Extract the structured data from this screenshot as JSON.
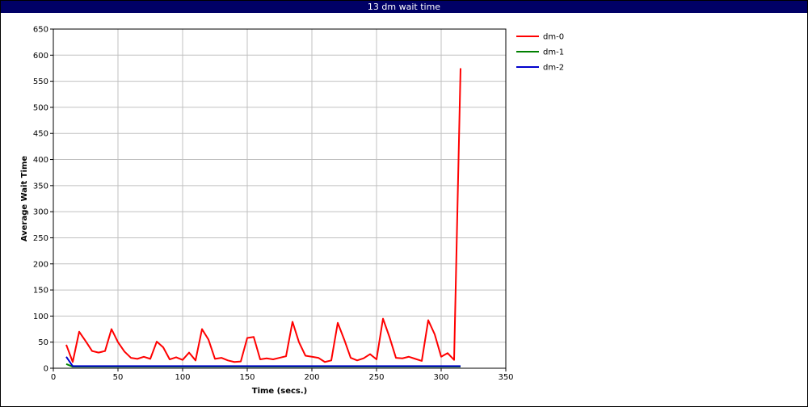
{
  "title": "13 dm wait time",
  "chart_data": {
    "type": "line",
    "title": "13 dm wait time",
    "xlabel": "Time (secs.)",
    "ylabel": "Average Wait Time",
    "xlim": [
      0,
      350
    ],
    "ylim": [
      0,
      650
    ],
    "x_ticks": [
      0,
      50,
      100,
      150,
      200,
      250,
      300,
      350
    ],
    "y_ticks": [
      0,
      50,
      100,
      150,
      200,
      250,
      300,
      350,
      400,
      450,
      500,
      550,
      600,
      650
    ],
    "grid": true,
    "legend_position": "right",
    "series": [
      {
        "name": "dm-0",
        "color": "#ff0000",
        "points": [
          [
            10,
            45
          ],
          [
            15,
            12
          ],
          [
            20,
            70
          ],
          [
            25,
            52
          ],
          [
            30,
            33
          ],
          [
            35,
            30
          ],
          [
            40,
            33
          ],
          [
            45,
            75
          ],
          [
            50,
            50
          ],
          [
            55,
            32
          ],
          [
            60,
            20
          ],
          [
            65,
            18
          ],
          [
            70,
            22
          ],
          [
            75,
            18
          ],
          [
            80,
            51
          ],
          [
            85,
            40
          ],
          [
            90,
            17
          ],
          [
            95,
            21
          ],
          [
            100,
            16
          ],
          [
            105,
            30
          ],
          [
            110,
            15
          ],
          [
            115,
            75
          ],
          [
            120,
            55
          ],
          [
            125,
            18
          ],
          [
            130,
            20
          ],
          [
            135,
            15
          ],
          [
            140,
            12
          ],
          [
            145,
            13
          ],
          [
            150,
            58
          ],
          [
            155,
            60
          ],
          [
            160,
            17
          ],
          [
            165,
            19
          ],
          [
            170,
            17
          ],
          [
            175,
            20
          ],
          [
            180,
            23
          ],
          [
            185,
            89
          ],
          [
            190,
            50
          ],
          [
            195,
            24
          ],
          [
            200,
            22
          ],
          [
            205,
            20
          ],
          [
            210,
            12
          ],
          [
            215,
            15
          ],
          [
            220,
            87
          ],
          [
            225,
            55
          ],
          [
            230,
            20
          ],
          [
            235,
            15
          ],
          [
            240,
            19
          ],
          [
            245,
            27
          ],
          [
            250,
            17
          ],
          [
            255,
            95
          ],
          [
            260,
            60
          ],
          [
            265,
            20
          ],
          [
            270,
            19
          ],
          [
            275,
            22
          ],
          [
            280,
            18
          ],
          [
            285,
            14
          ],
          [
            290,
            92
          ],
          [
            295,
            65
          ],
          [
            300,
            22
          ],
          [
            305,
            29
          ],
          [
            310,
            16
          ],
          [
            315,
            575
          ]
        ]
      },
      {
        "name": "dm-1",
        "color": "#008000",
        "points": [
          [
            10,
            8
          ],
          [
            15,
            3
          ],
          [
            20,
            3
          ],
          [
            315,
            3
          ]
        ]
      },
      {
        "name": "dm-2",
        "color": "#0000cc",
        "points": [
          [
            10,
            22
          ],
          [
            15,
            4
          ],
          [
            20,
            4
          ],
          [
            315,
            4
          ]
        ]
      }
    ]
  }
}
